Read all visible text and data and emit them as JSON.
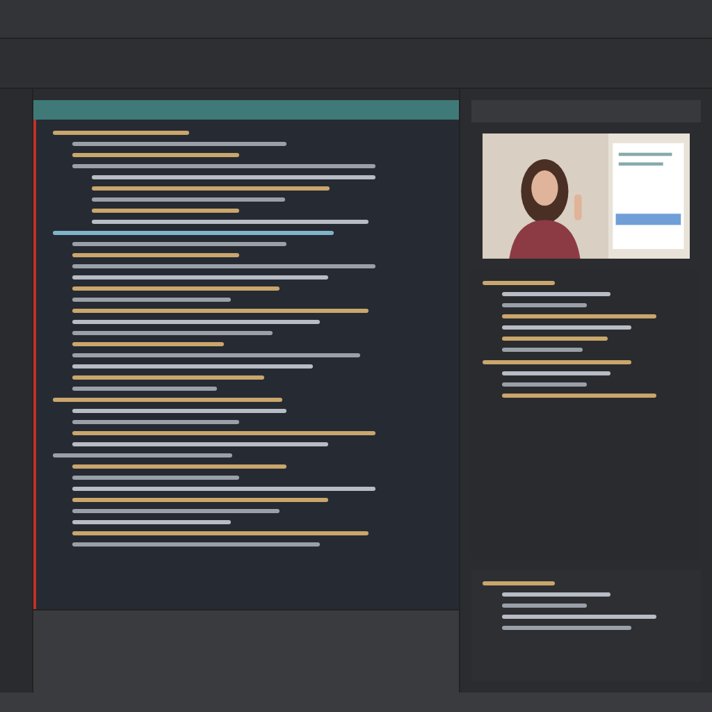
{
  "editor": {
    "blocks": [
      {
        "color": "#c9a66b",
        "children": [
          {
            "color": "#9aa0a8"
          },
          {
            "color": "#c9a66b"
          },
          {
            "color": "#9aa0a8",
            "children": [
              {
                "color": "#b8bcc4"
              },
              {
                "color": "#c9a66b"
              },
              {
                "color": "#9aa0a8"
              },
              {
                "color": "#c9a66b"
              },
              {
                "color": "#b8bcc4"
              }
            ]
          }
        ]
      },
      {
        "color": "#7fb3c8",
        "children": [
          {
            "color": "#9aa0a8"
          },
          {
            "color": "#c9a66b"
          },
          {
            "color": "#9aa0a8"
          },
          {
            "color": "#b8bcc4"
          },
          {
            "color": "#c9a66b"
          },
          {
            "color": "#9aa0a8"
          },
          {
            "color": "#c9a66b"
          },
          {
            "color": "#b8bcc4"
          },
          {
            "color": "#9aa0a8"
          },
          {
            "color": "#c9a66b"
          },
          {
            "color": "#9aa0a8"
          },
          {
            "color": "#b8bcc4"
          },
          {
            "color": "#c9a66b"
          },
          {
            "color": "#9aa0a8"
          }
        ]
      },
      {
        "color": "#c9a66b",
        "children": [
          {
            "color": "#b8bcc4"
          },
          {
            "color": "#9aa0a8"
          },
          {
            "color": "#c9a66b"
          },
          {
            "color": "#b8bcc4"
          }
        ]
      },
      {
        "color": "#9aa0a8",
        "children": [
          {
            "color": "#c9a66b"
          },
          {
            "color": "#9aa0a8"
          },
          {
            "color": "#b8bcc4"
          },
          {
            "color": "#c9a66b"
          },
          {
            "color": "#9aa0a8"
          },
          {
            "color": "#b8bcc4"
          },
          {
            "color": "#c9a66b"
          },
          {
            "color": "#9aa0a8"
          }
        ]
      }
    ]
  },
  "side": {
    "blocks": [
      {
        "color": "#c9a66b",
        "children": [
          {
            "color": "#b8bcc4"
          },
          {
            "color": "#9aa0a8"
          },
          {
            "color": "#c9a66b"
          },
          {
            "color": "#b8bcc4"
          },
          {
            "color": "#c9a66b"
          },
          {
            "color": "#9aa0a8"
          }
        ]
      },
      {
        "color": "#c9a66b",
        "children": [
          {
            "color": "#b8bcc4"
          },
          {
            "color": "#9aa0a8"
          },
          {
            "color": "#c9a66b"
          }
        ]
      }
    ]
  },
  "bottom": {
    "blocks": [
      {
        "color": "#c9a66b",
        "children": [
          {
            "color": "#b8bcc4"
          },
          {
            "color": "#9aa0a8"
          },
          {
            "color": "#b8bcc4"
          },
          {
            "color": "#9aa0a8"
          }
        ]
      }
    ]
  }
}
